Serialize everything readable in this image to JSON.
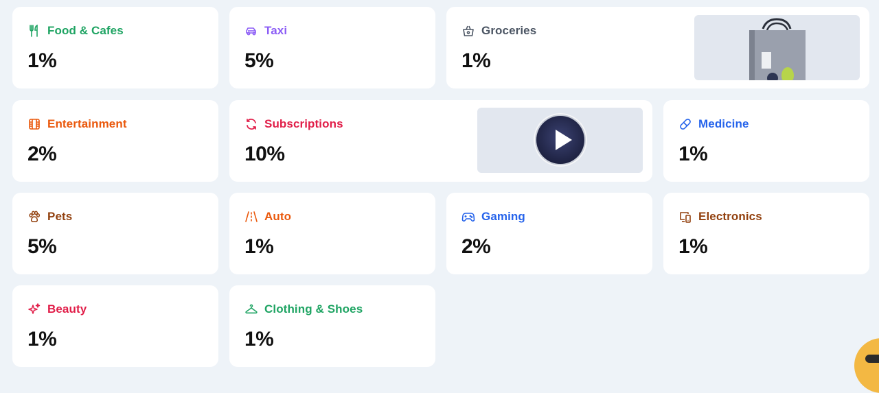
{
  "categories": [
    {
      "id": "food",
      "label": "Food & Cafes",
      "value": "1%",
      "color": "#1fa463",
      "icon": "fork-knife-icon"
    },
    {
      "id": "taxi",
      "label": "Taxi",
      "value": "5%",
      "color": "#8b5cf6",
      "icon": "car-icon"
    },
    {
      "id": "groceries",
      "label": "Groceries",
      "value": "1%",
      "color": "#4b5563",
      "icon": "basket-icon"
    },
    {
      "id": "entertainment",
      "label": "Entertainment",
      "value": "2%",
      "color": "#ea580c",
      "icon": "film-icon"
    },
    {
      "id": "subscriptions",
      "label": "Subscriptions",
      "value": "10%",
      "color": "#e11d48",
      "icon": "refresh-icon"
    },
    {
      "id": "medicine",
      "label": "Medicine",
      "value": "1%",
      "color": "#2563eb",
      "icon": "pill-icon"
    },
    {
      "id": "pets",
      "label": "Pets",
      "value": "5%",
      "color": "#92400e",
      "icon": "paw-icon"
    },
    {
      "id": "auto",
      "label": "Auto",
      "value": "1%",
      "color": "#ea580c",
      "icon": "road-icon"
    },
    {
      "id": "gaming",
      "label": "Gaming",
      "value": "2%",
      "color": "#2563eb",
      "icon": "gamepad-icon"
    },
    {
      "id": "electronics",
      "label": "Electronics",
      "value": "1%",
      "color": "#92400e",
      "icon": "devices-icon"
    },
    {
      "id": "beauty",
      "label": "Beauty",
      "value": "1%",
      "color": "#e11d48",
      "icon": "sparkle-icon"
    },
    {
      "id": "clothing",
      "label": "Clothing & Shoes",
      "value": "1%",
      "color": "#1fa463",
      "icon": "hanger-icon"
    }
  ],
  "promos": [
    {
      "id": "groceries-promo",
      "icon": "shopping-bag-icon"
    },
    {
      "id": "subscriptions-promo",
      "icon": "play-icon"
    }
  ],
  "fab": {
    "icon": "chat-icon",
    "color": "#f3b843"
  }
}
